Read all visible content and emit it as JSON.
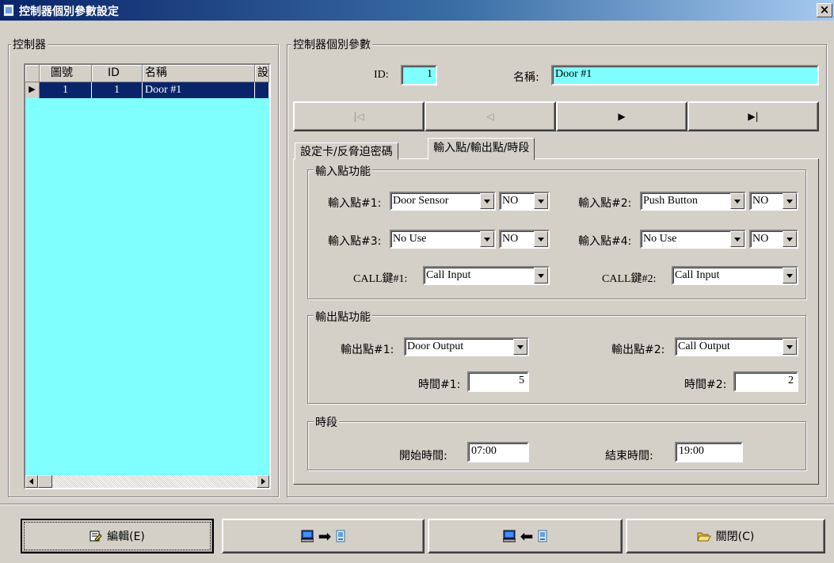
{
  "window": {
    "title": "控制器個別參數設定",
    "close_glyph": "×"
  },
  "controller_list": {
    "group_label": "控制器",
    "columns": [
      "圖號",
      "ID",
      "名稱",
      "設"
    ],
    "rows": [
      {
        "no": "1",
        "id": "1",
        "name": "Door #1"
      }
    ],
    "row_indicator": "▶"
  },
  "params": {
    "group_label": "控制器個別參數",
    "id_label": "ID:",
    "id_value": "1",
    "name_label": "名稱:",
    "name_value": "Door #1",
    "nav": {
      "first": "|◁",
      "prev": "◁",
      "next": "▶",
      "last": "▶|"
    }
  },
  "tabs": [
    {
      "label": "設定卡/反脅迫密碼",
      "active": false
    },
    {
      "label": "輸入點/輸出點/時段",
      "active": true
    }
  ],
  "input_points": {
    "group_label": "輸入點功能",
    "in1": {
      "label": "輸入點#1:",
      "value": "Door Sensor",
      "mode": "NO"
    },
    "in2": {
      "label": "輸入點#2:",
      "value": "Push Button",
      "mode": "NO"
    },
    "in3": {
      "label": "輸入點#3:",
      "value": "No Use",
      "mode": "NO"
    },
    "in4": {
      "label": "輸入點#4:",
      "value": "No Use",
      "mode": "NO"
    },
    "call1": {
      "label": "CALL鍵#1:",
      "value": "Call Input"
    },
    "call2": {
      "label": "CALL鍵#2:",
      "value": "Call Input"
    }
  },
  "output_points": {
    "group_label": "輸出點功能",
    "out1": {
      "label": "輸出點#1:",
      "value": "Door Output"
    },
    "out2": {
      "label": "輸出點#2:",
      "value": "Call Output"
    },
    "time1": {
      "label": "時間#1:",
      "value": "5"
    },
    "time2": {
      "label": "時間#2:",
      "value": "2"
    }
  },
  "time_period": {
    "group_label": "時段",
    "start_label": "開始時間:",
    "start_value": "07:00",
    "end_label": "結束時間:",
    "end_value": "19:00"
  },
  "buttons": {
    "edit": "編輯(E)",
    "upload_arrow": "➡",
    "download_arrow": "⬅",
    "close": "關閉(C)"
  },
  "colors": {
    "grid_bg": "#80ffff",
    "field_highlight": "#80ffff",
    "selection": "#0a246a",
    "face": "#d4d0c8"
  }
}
